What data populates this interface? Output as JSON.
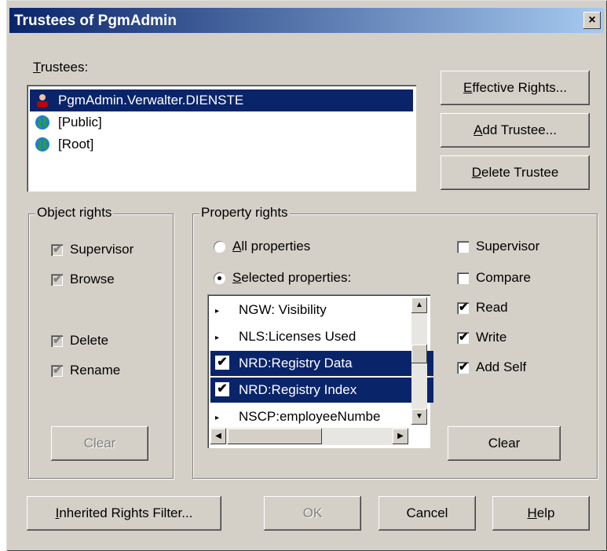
{
  "window": {
    "title": "Trustees of PgmAdmin",
    "close_glyph": "×"
  },
  "trustees": {
    "label_key": "T",
    "label_rest": "rustees:",
    "items": [
      {
        "name": "PgmAdmin.Verwalter.DIENSTE",
        "icon": "user-icon",
        "selected": true
      },
      {
        "name": "[Public]",
        "icon": "globe-icon",
        "selected": false
      },
      {
        "name": "[Root]",
        "icon": "globe-icon",
        "selected": false
      }
    ]
  },
  "buttons": {
    "effective_rights": {
      "key": "E",
      "rest": "ffective Rights..."
    },
    "add_trustee": {
      "key": "A",
      "rest": "dd Trustee..."
    },
    "delete_trustee": {
      "key": "D",
      "rest": "elete Trustee"
    },
    "inherited_rights": {
      "key": "I",
      "rest": "nherited Rights Filter..."
    },
    "ok": "OK",
    "cancel": "Cancel",
    "help": {
      "key": "H",
      "rest": "elp"
    },
    "clear_object": "Clear",
    "clear_property": "Clear"
  },
  "object_rights": {
    "title": "Object rights",
    "items": [
      {
        "label": "Supervisor",
        "checked": true
      },
      {
        "label": "Browse",
        "checked": true
      },
      {
        "label": "Delete",
        "checked": true
      },
      {
        "label": "Rename",
        "checked": true
      }
    ]
  },
  "property_rights": {
    "title": "Property rights",
    "all_properties": {
      "key": "A",
      "rest": "ll properties",
      "selected": false
    },
    "selected_properties": {
      "key": "S",
      "rest": "elected properties:",
      "selected": true
    },
    "properties": [
      {
        "name": "NGW: Visibility",
        "checked": false,
        "selected": false
      },
      {
        "name": "NLS:Licenses Used",
        "checked": false,
        "selected": false
      },
      {
        "name": "NRD:Registry Data",
        "checked": true,
        "selected": true
      },
      {
        "name": "NRD:Registry Index",
        "checked": true,
        "selected": true
      },
      {
        "name": "NSCP:employeeNumbe",
        "checked": false,
        "selected": false
      }
    ],
    "rights": [
      {
        "label": "Supervisor",
        "checked": false
      },
      {
        "label": "Compare",
        "checked": false
      },
      {
        "label": "Read",
        "checked": true
      },
      {
        "label": "Write",
        "checked": true
      },
      {
        "label": "Add Self",
        "checked": true
      }
    ]
  },
  "glyphs": {
    "check": "✔",
    "up": "▲",
    "down": "▼",
    "left": "◀",
    "right": "▶",
    "marker": "▸"
  }
}
